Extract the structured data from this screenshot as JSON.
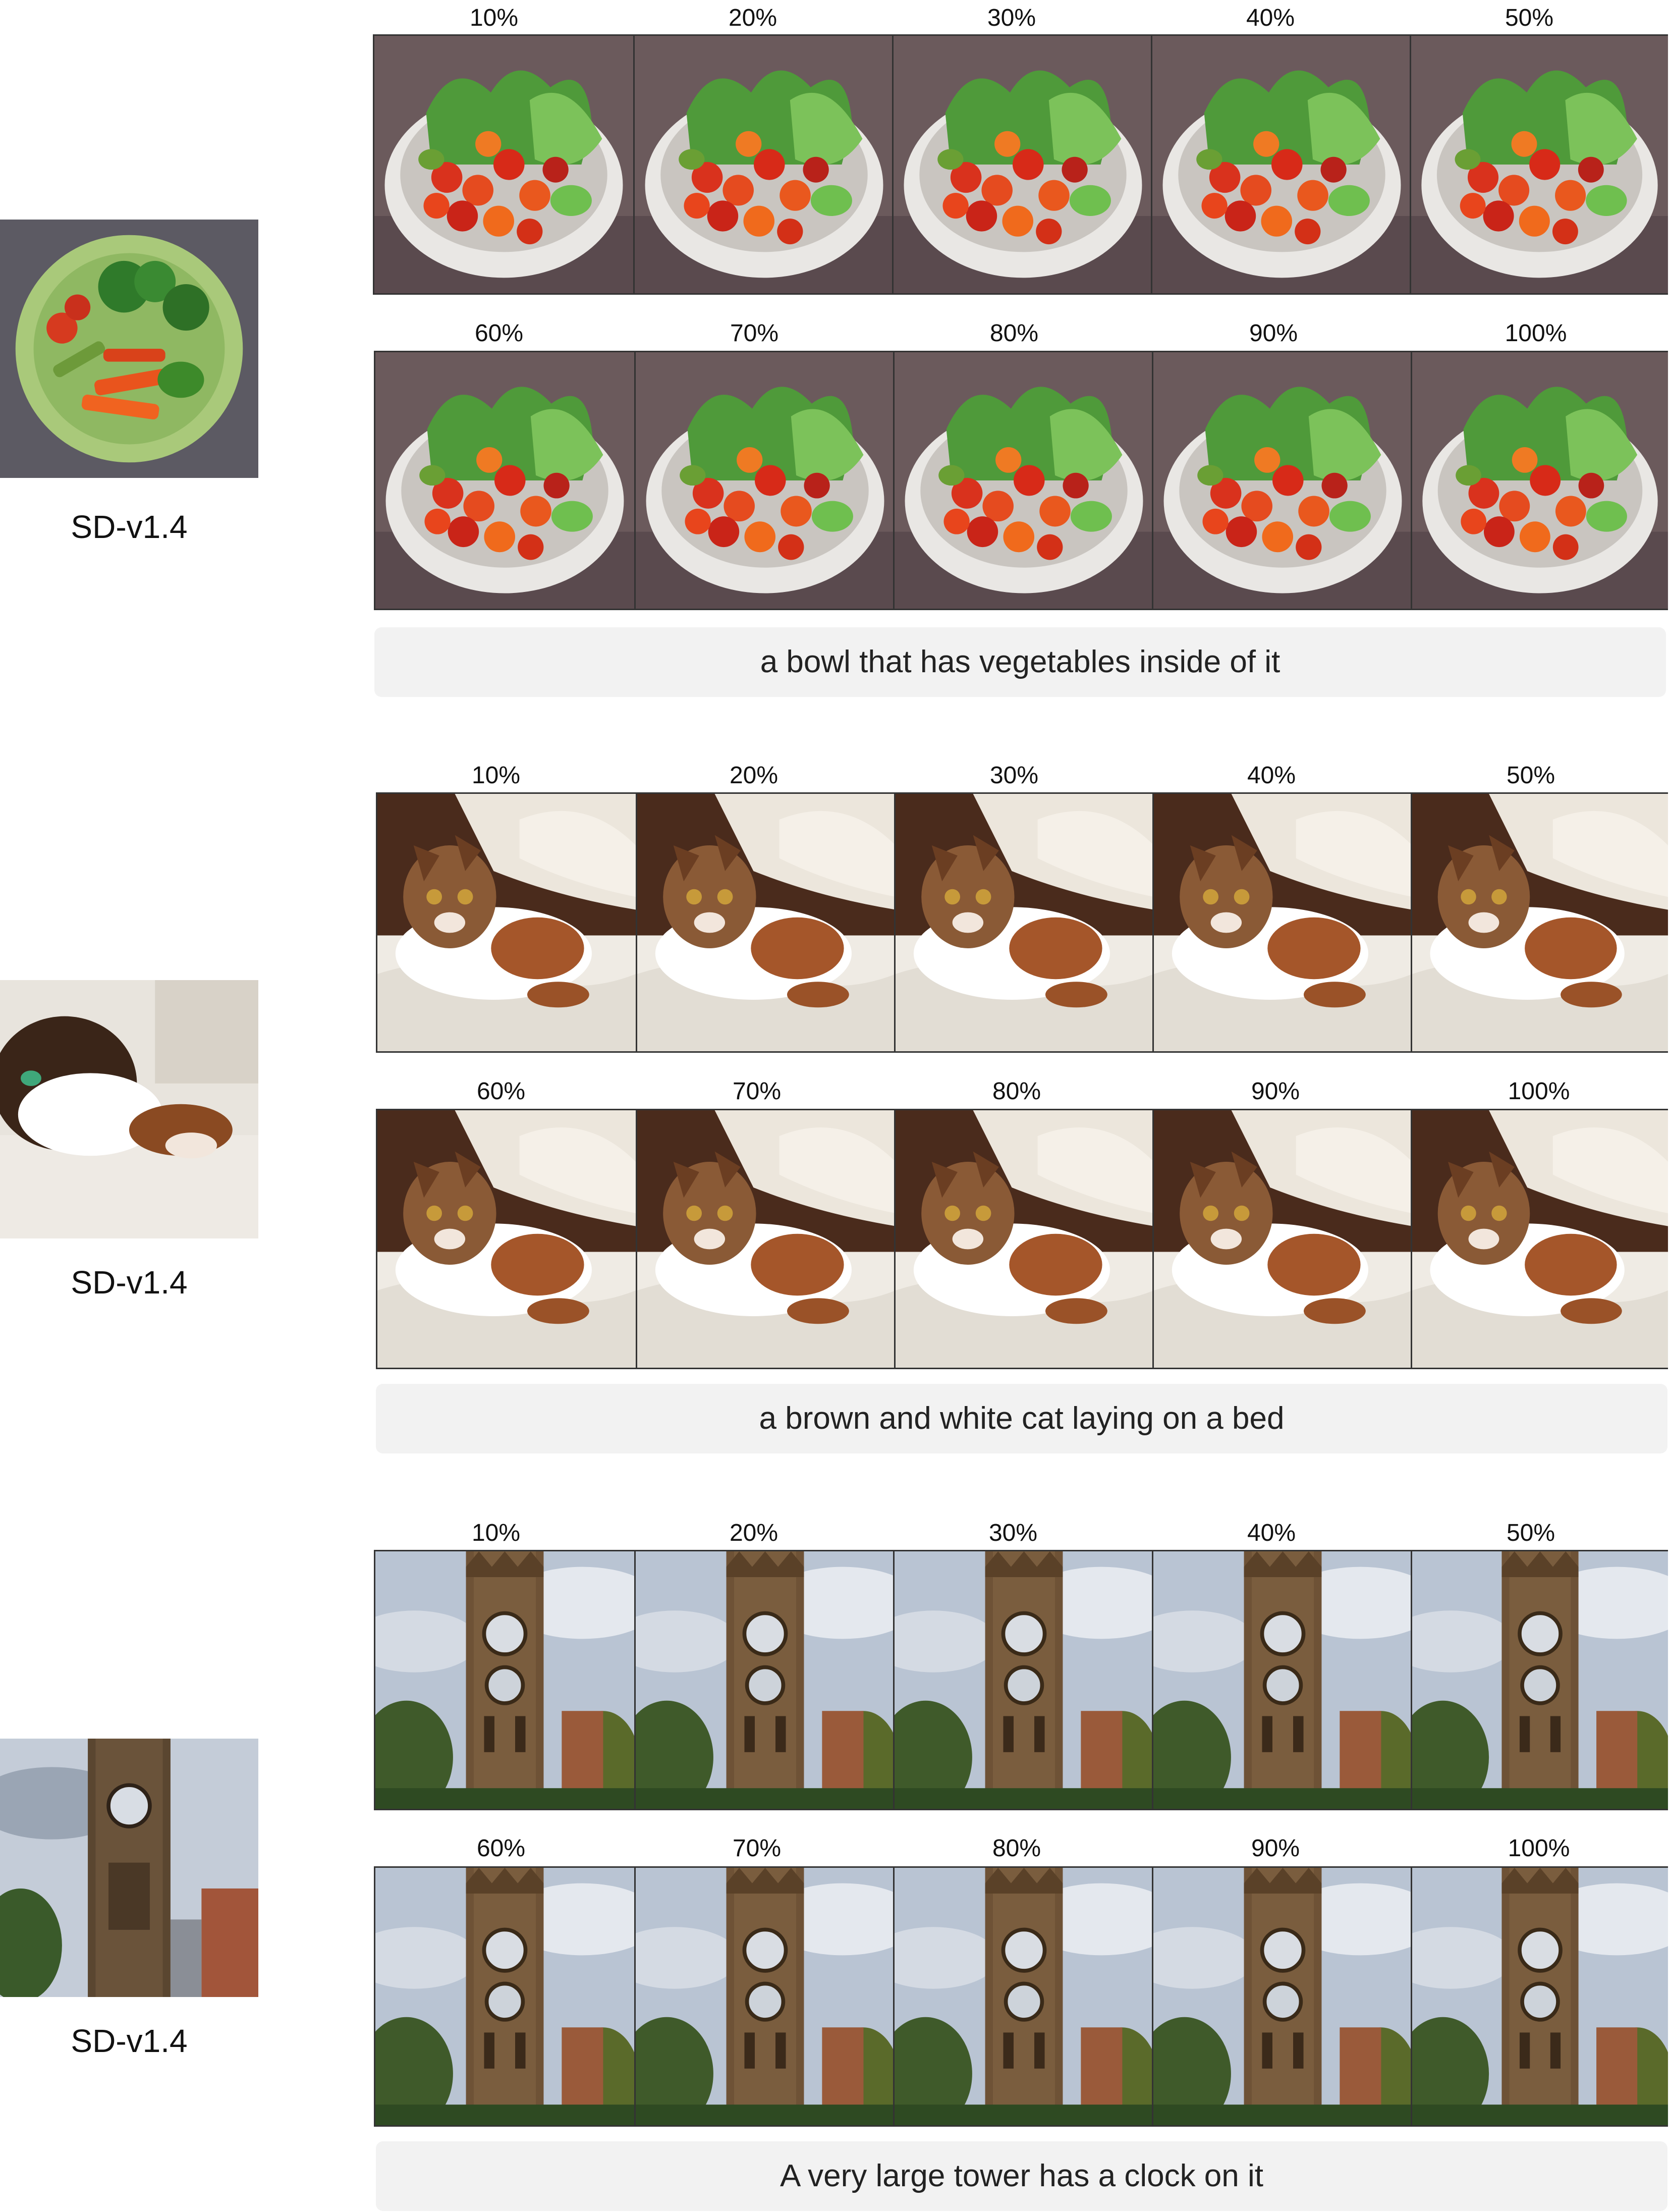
{
  "rows": [
    {
      "model_label": "SD-v1.4",
      "subject_icon": "vegetable-bowl",
      "caption": "a bowl that has vegetables inside of it",
      "top_percents": [
        "10%",
        "20%",
        "30%",
        "40%",
        "50%"
      ],
      "bottom_percents": [
        "60%",
        "70%",
        "80%",
        "90%",
        "100%"
      ]
    },
    {
      "model_label": "SD-v1.4",
      "subject_icon": "cat-on-bed",
      "caption": "a brown and white cat laying on a bed",
      "top_percents": [
        "10%",
        "20%",
        "30%",
        "40%",
        "50%"
      ],
      "bottom_percents": [
        "60%",
        "70%",
        "80%",
        "90%",
        "100%"
      ]
    },
    {
      "model_label": "SD-v1.4",
      "subject_icon": "clock-tower",
      "caption": "A very large tower has a clock on it",
      "top_percents": [
        "10%",
        "20%",
        "30%",
        "40%",
        "50%"
      ],
      "bottom_percents": [
        "60%",
        "70%",
        "80%",
        "90%",
        "100%"
      ]
    }
  ]
}
